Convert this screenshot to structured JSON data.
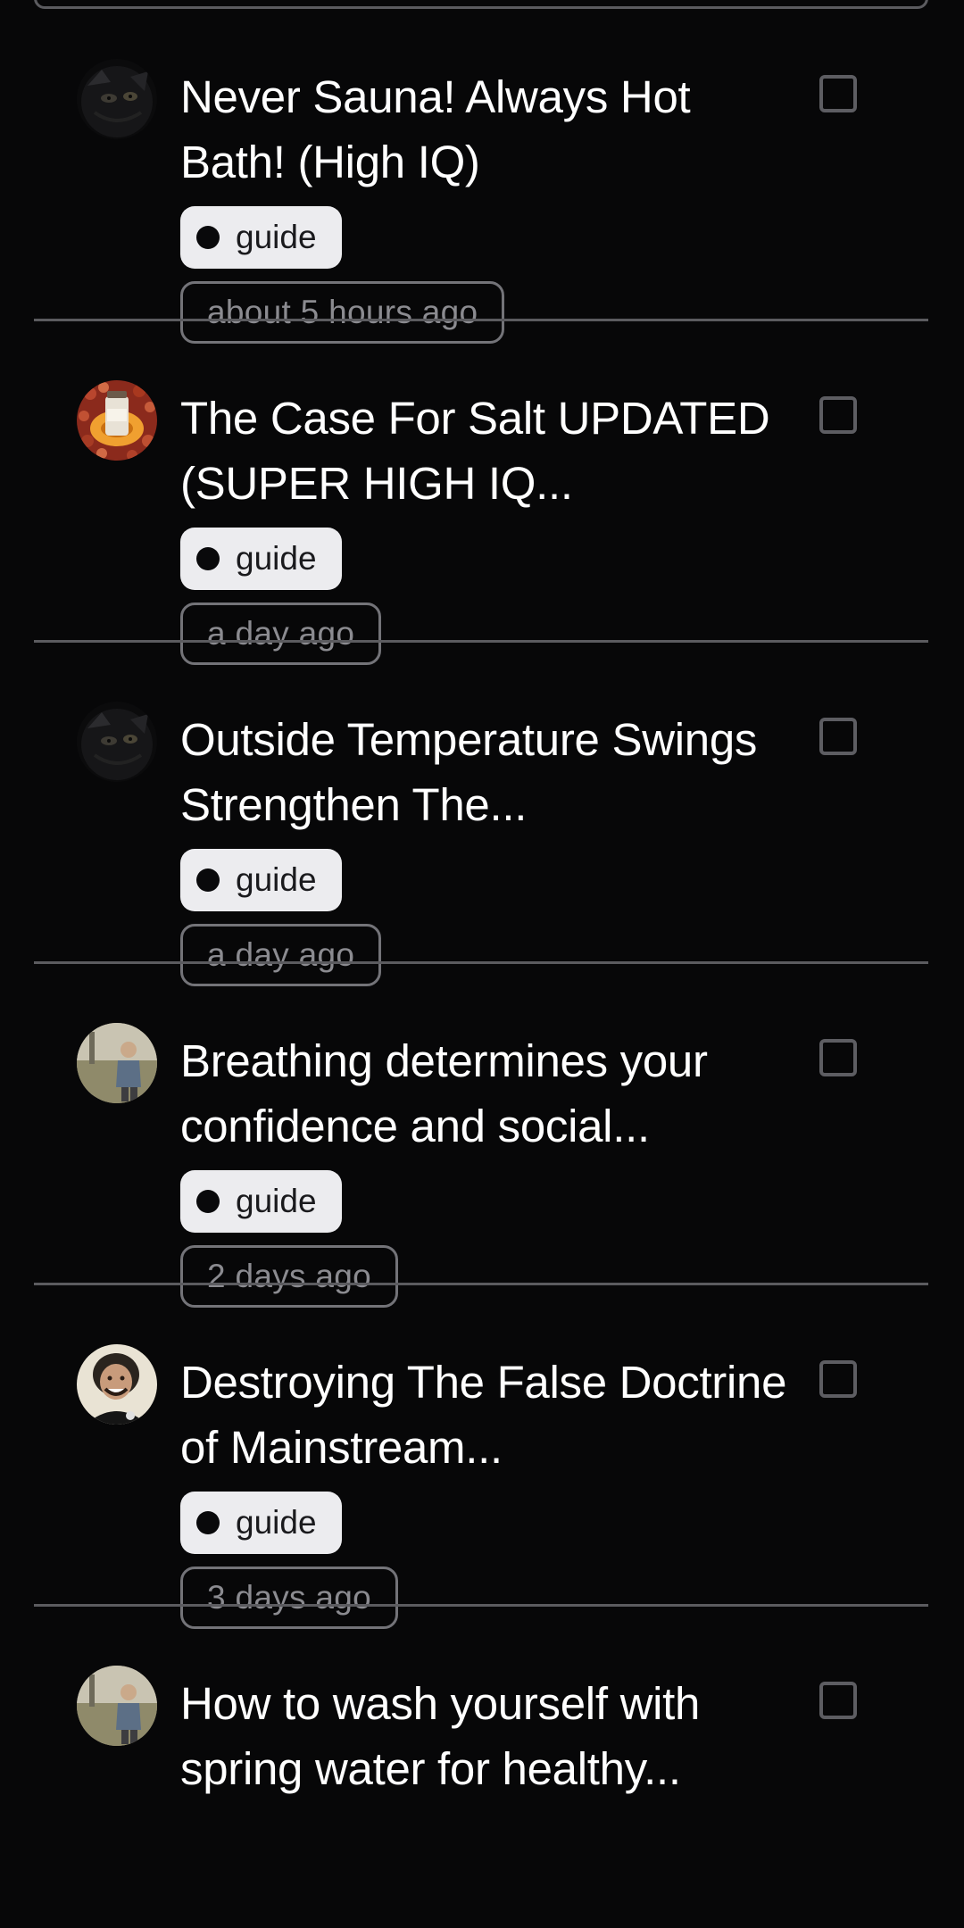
{
  "posts": [
    {
      "title": "Never Sauna! Always Hot Bath! (High IQ)",
      "tag": "guide",
      "time": "about 5 hours ago",
      "avatar": "dark-cat-avatar"
    },
    {
      "title": "The Case For Salt UPDATED (SUPER HIGH IQ...",
      "tag": "guide",
      "time": "a day ago",
      "avatar": "vial-and-beans-avatar"
    },
    {
      "title": "Outside Temperature Swings Strengthen The...",
      "tag": "guide",
      "time": "a day ago",
      "avatar": "dark-cat-avatar"
    },
    {
      "title": "Breathing determines your confidence and social...",
      "tag": "guide",
      "time": "2 days ago",
      "avatar": "person-in-field-avatar"
    },
    {
      "title": "Destroying The False Doctrine of Mainstream...",
      "tag": "guide",
      "time": "3 days ago",
      "avatar": "laughing-man-avatar"
    },
    {
      "title": "How to wash yourself with spring water for healthy...",
      "tag": "guide",
      "time": "",
      "avatar": "person-in-field-avatar"
    }
  ]
}
